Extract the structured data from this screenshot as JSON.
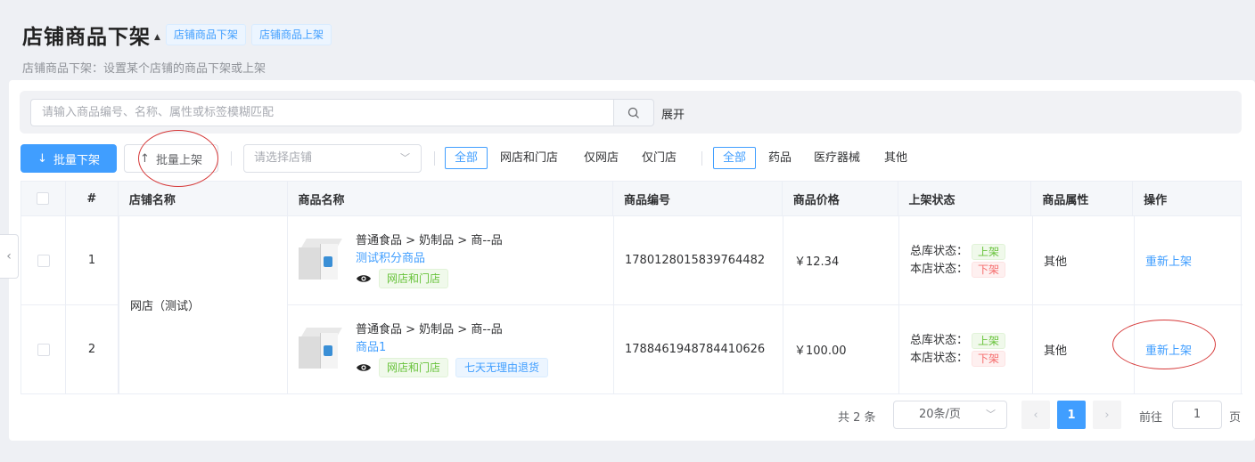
{
  "header": {
    "title": "店铺商品下架",
    "tabs": [
      "店铺商品下架",
      "店铺商品上架"
    ],
    "subtitle": "店铺商品下架：设置某个店铺的商品下架或上架"
  },
  "search": {
    "placeholder": "请输入商品编号、名称、属性或标签模糊匹配",
    "value": "",
    "expand_label": "展开"
  },
  "toolbar": {
    "batch_off_label": "批量下架",
    "batch_on_label": "批量上架",
    "store_placeholder": "请选择店铺",
    "channel_filters": [
      "全部",
      "网店和门店",
      "仅网店",
      "仅门店"
    ],
    "category_filters": [
      "全部",
      "药品",
      "医疗器械",
      "其他"
    ]
  },
  "table": {
    "columns": [
      "#",
      "店铺名称",
      "商品名称",
      "商品编号",
      "商品价格",
      "上架状态",
      "商品属性",
      "操作"
    ],
    "store_name": "网店（测试）",
    "rows": [
      {
        "index": "1",
        "category_path": "普通食品 > 奶制品 > 商--品",
        "product_name": "测试积分商品",
        "tags": [
          "网店和门店"
        ],
        "code": "1780128015839764482",
        "price": "￥12.34",
        "hq_status_label": "总库状态：",
        "hq_status": "上架",
        "store_status_label": "本店状态：",
        "store_status": "下架",
        "attribute": "其他",
        "action": "重新上架"
      },
      {
        "index": "2",
        "category_path": "普通食品 > 奶制品 > 商--品",
        "product_name": "商品1",
        "tags": [
          "网店和门店",
          "七天无理由退货"
        ],
        "code": "1788461948784410626",
        "price": "￥100.00",
        "hq_status_label": "总库状态：",
        "hq_status": "上架",
        "store_status_label": "本店状态：",
        "store_status": "下架",
        "attribute": "其他",
        "action": "重新上架"
      }
    ]
  },
  "pagination": {
    "total": "共 2 条",
    "page_size": "20条/页",
    "current_page": "1",
    "goto_prefix": "前往",
    "goto_value": "1",
    "goto_suffix": "页"
  },
  "colors": {
    "primary": "#409eff",
    "success": "#67c23a",
    "danger": "#f56c6c",
    "annotation": "#d63a3a"
  }
}
